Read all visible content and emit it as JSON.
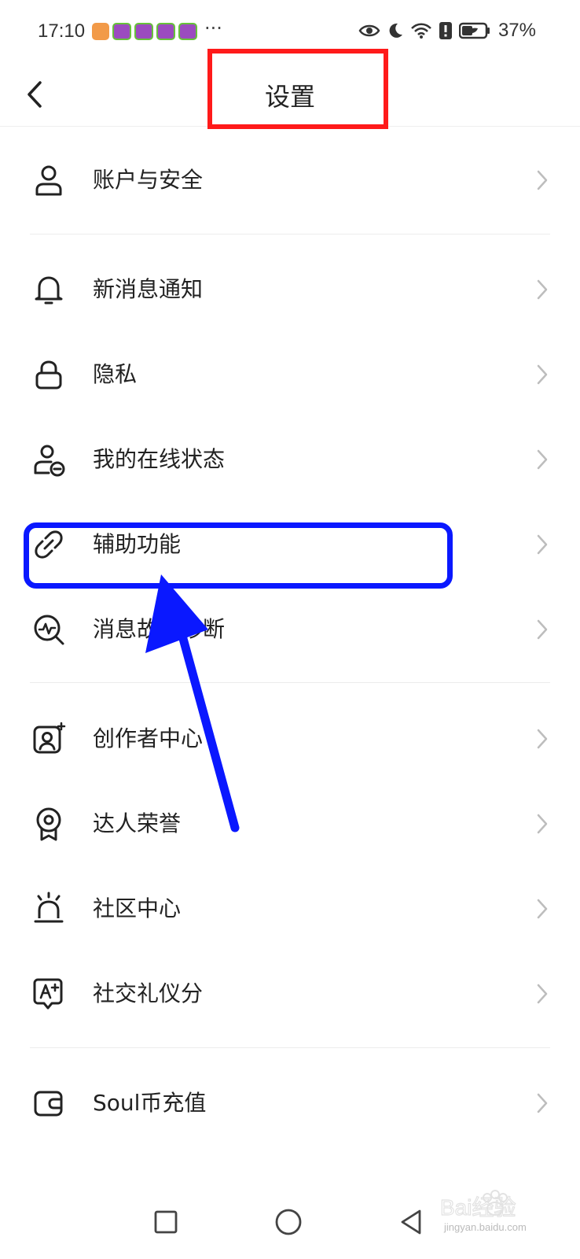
{
  "status_bar": {
    "time": "17:10",
    "more_dots": "···",
    "battery_percent": "37%",
    "icons": [
      "app-orange-icon",
      "game-app-icon",
      "game-app-icon",
      "game-app-icon",
      "game-app-icon",
      "eye-icon",
      "moon-icon",
      "wifi-icon",
      "alert-icon",
      "battery-icon"
    ]
  },
  "header": {
    "title": "设置",
    "back_icon": "chevron-left-icon"
  },
  "settings": {
    "items": [
      {
        "label": "账户与安全",
        "icon": "user-icon"
      },
      {
        "label": "新消息通知",
        "icon": "bell-icon"
      },
      {
        "label": "隐私",
        "icon": "lock-icon"
      },
      {
        "label": "我的在线状态",
        "icon": "user-status-icon"
      },
      {
        "label": "辅助功能",
        "icon": "link-icon"
      },
      {
        "label": "消息故障诊断",
        "icon": "diagnose-icon"
      },
      {
        "label": "创作者中心",
        "icon": "creator-icon"
      },
      {
        "label": "达人荣誉",
        "icon": "badge-icon"
      },
      {
        "label": "社区中心",
        "icon": "alarm-light-icon"
      },
      {
        "label": "社交礼仪分",
        "icon": "score-icon"
      },
      {
        "label": "Soul币充值",
        "icon": "wallet-icon"
      }
    ]
  },
  "nav_bar": {
    "icons": [
      "square-recents-icon",
      "circle-home-icon",
      "triangle-back-icon"
    ]
  },
  "watermark": {
    "text": "Bai经验",
    "url_text": "jingyan.baidu.com"
  },
  "colors": {
    "title_highlight": "#ff1a1a",
    "focus_highlight": "#0a18ff",
    "arrow": "#0a18ff",
    "divider": "#ececec"
  }
}
